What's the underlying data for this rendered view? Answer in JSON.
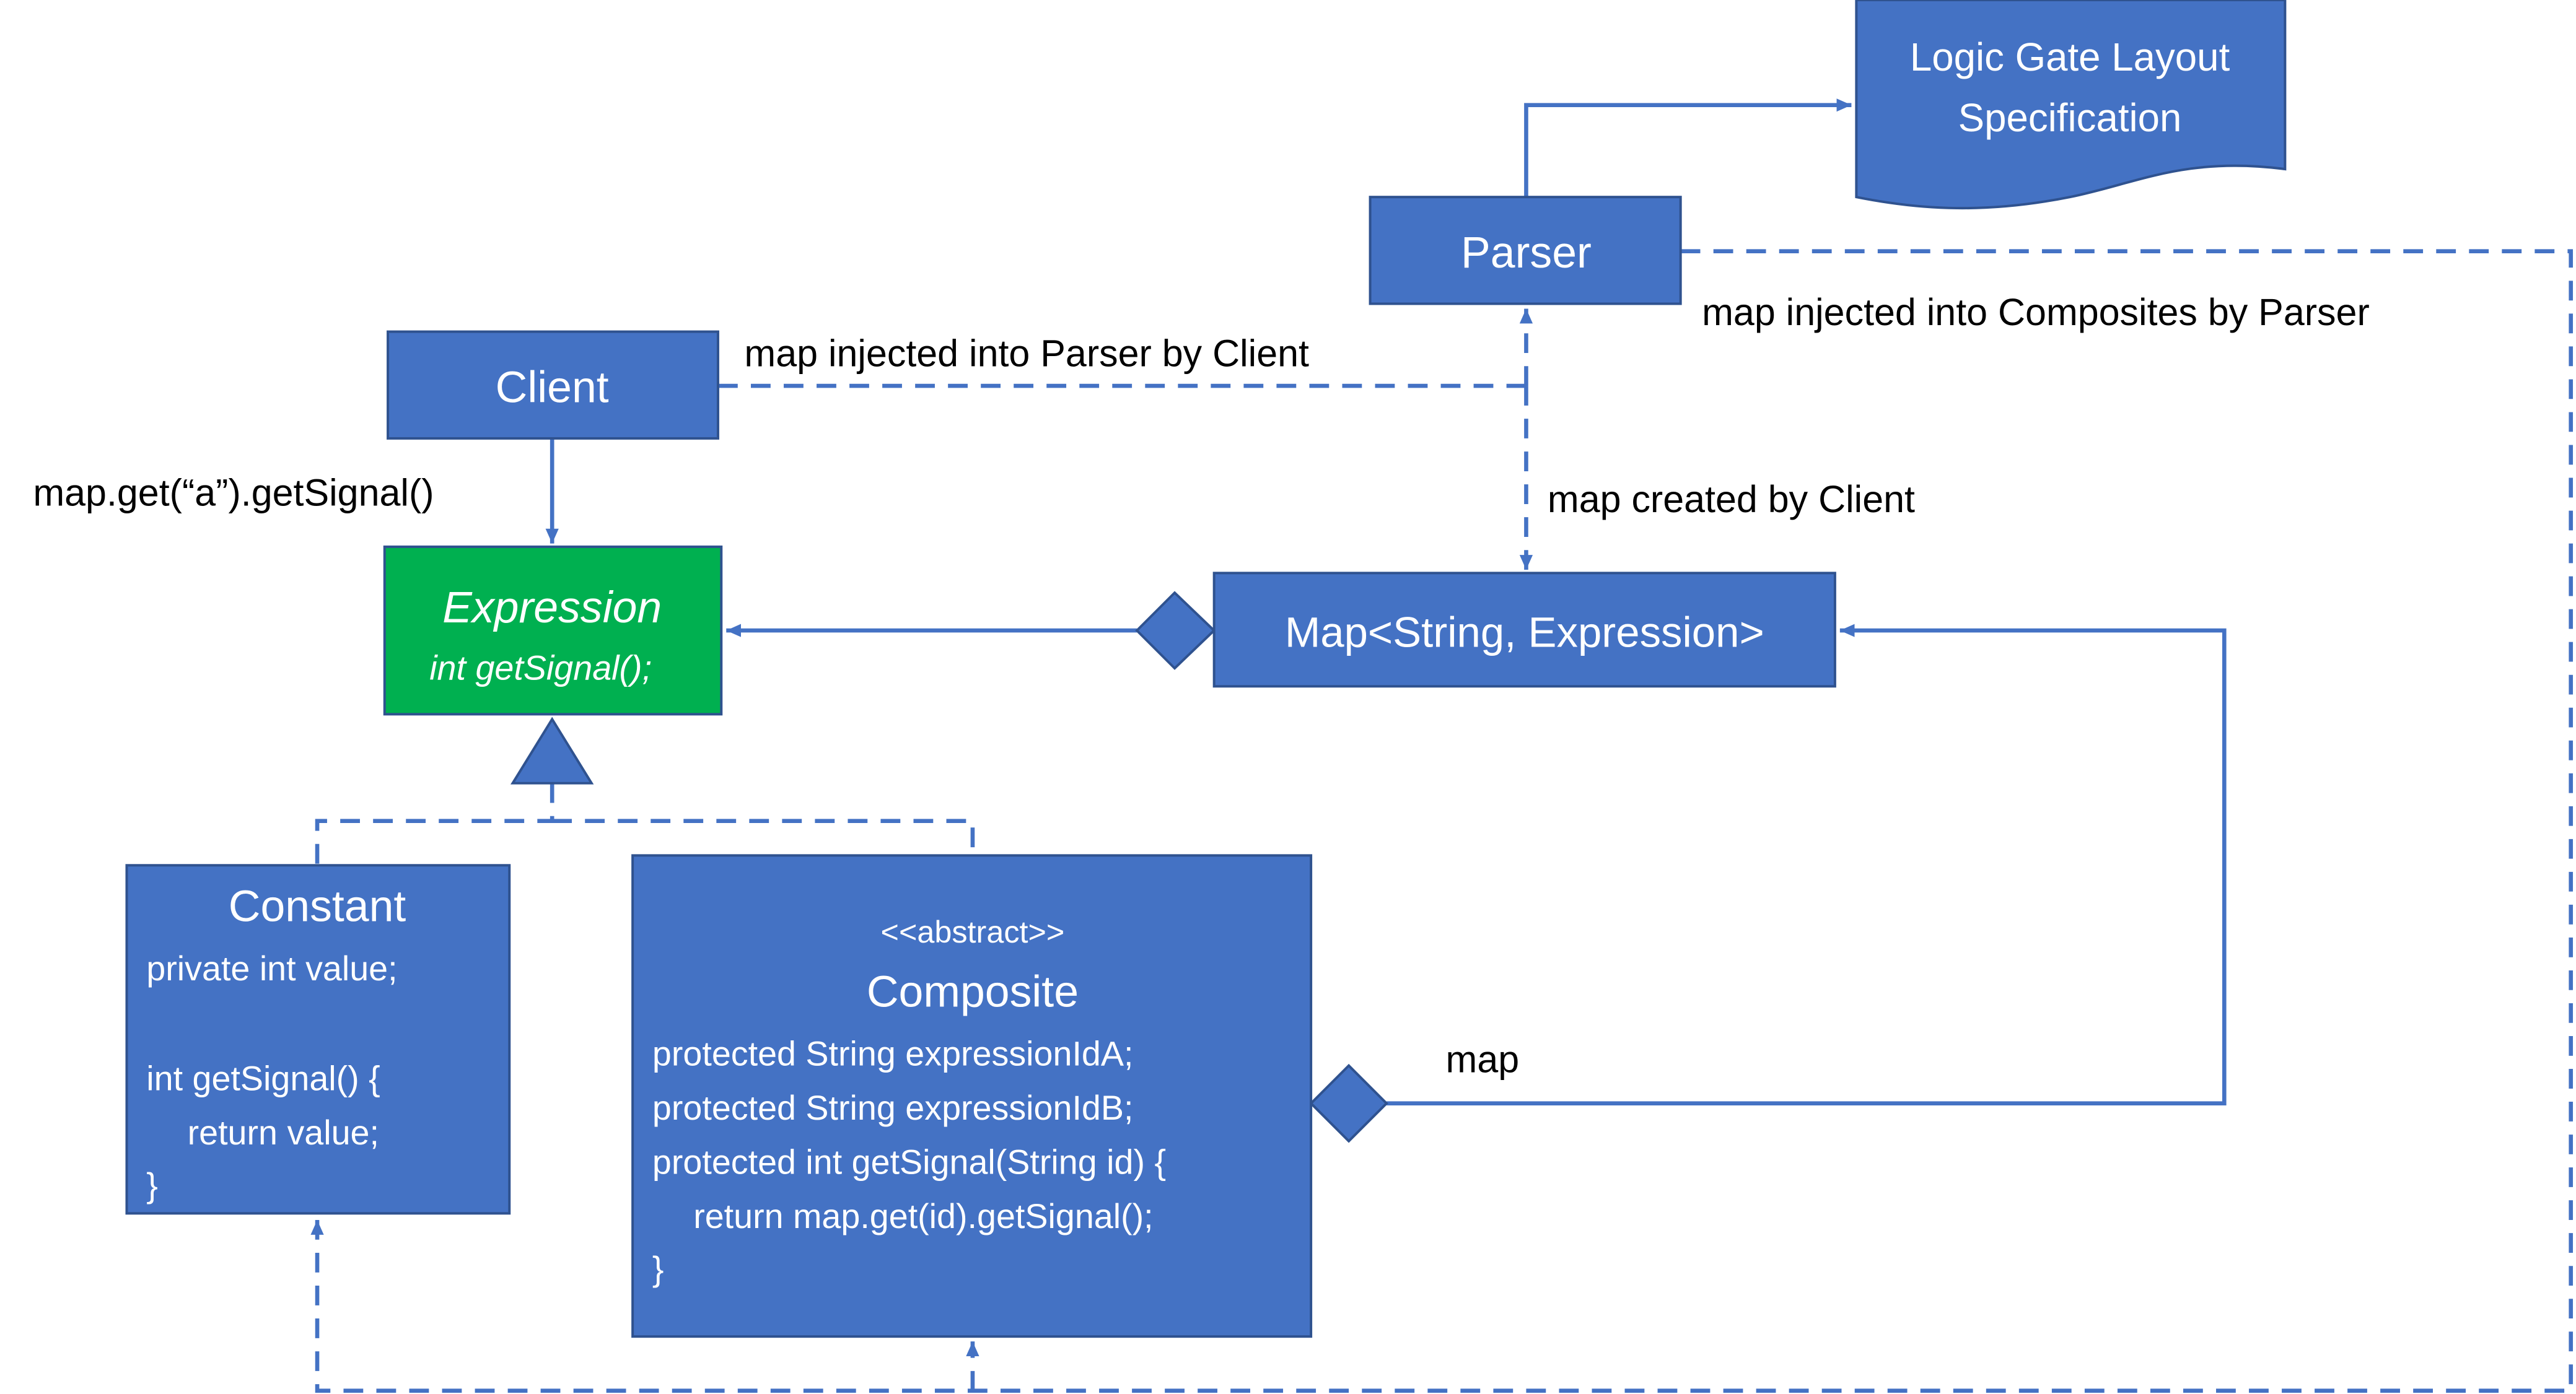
{
  "colors": {
    "box": "#4472c4",
    "box_border": "#2f528f",
    "interface": "#00b050",
    "line": "#4472c4"
  },
  "document": {
    "line1": "Logic Gate Layout",
    "line2": "Specification"
  },
  "parser": {
    "label": "Parser"
  },
  "client": {
    "label": "Client"
  },
  "map_box": {
    "label": "Map<String, Expression>"
  },
  "expression": {
    "name": "Expression",
    "method": "int getSignal();"
  },
  "constant": {
    "name": "Constant",
    "lines": [
      "private int value;",
      "int getSignal() {",
      "return value;",
      "}"
    ]
  },
  "composite": {
    "stereotype": "<<abstract>>",
    "name": "Composite",
    "lines": [
      "protected String expressionIdA;",
      "protected String expressionIdB;",
      "protected int getSignal(String id) {",
      "return map.get(id).getSignal();",
      "}"
    ]
  },
  "labels": {
    "injected_parser": "map injected into Parser by Client",
    "injected_composites": "map injected into Composites by Parser",
    "created": "map created by Client",
    "call": "map.get(“a”).getSignal()",
    "map": "map"
  }
}
